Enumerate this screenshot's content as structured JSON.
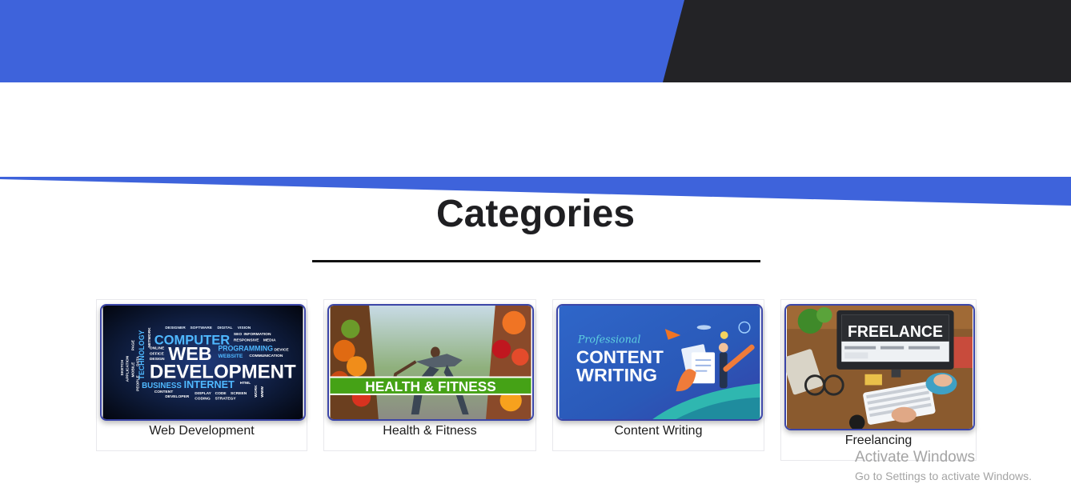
{
  "header": {
    "accent_color": "#3e63db",
    "dark_color": "#232326"
  },
  "section": {
    "title": "Categories"
  },
  "categories": [
    {
      "label": "Web Development",
      "image": "web-development-word-cloud",
      "image_text": {
        "w1": "COMPUTER",
        "w2": "WEB",
        "w3": "DEVELOPMENT",
        "w4": "BUSINESS",
        "w5": "INTERNET",
        "w6": "PROGRAMMING",
        "w7": "WEBSITE",
        "w8": "TECHNOLOGY",
        "w9": "DESIGNER",
        "w10": "SOFTWARE",
        "w11": "DIGITAL",
        "w12": "VISION",
        "w13": "SEO",
        "w14": "INFORMATION",
        "w15": "RESPONSIVE",
        "w16": "MEDIA",
        "w17": "DEVICE",
        "w18": "COMMUNICATION",
        "w19": "HTML",
        "w20": "DISPLAY",
        "w21": "CODE",
        "w22": "SCREEN",
        "w23": "CODING",
        "w24": "STRATEGY",
        "w25": "CONTENT",
        "w26": "DEVELOPER",
        "w27": "ONLINE",
        "w28": "OFFICE",
        "w29": "DESIGN",
        "w30": "SKETCH",
        "w31": "MOBILE",
        "w32": "PAGE",
        "w33": "APPLICATION",
        "w34": "PEOPLE",
        "w35": "LAPTOP",
        "w36": "PROGRAM",
        "w37": "DATA",
        "w38": "NETWORK",
        "w39": "WORK",
        "w40": "WWW"
      }
    },
    {
      "label": "Health & Fitness",
      "image": "health-fitness-banner",
      "image_text": {
        "banner": "HEALTH & FITNESS"
      }
    },
    {
      "label": "Content Writing",
      "image": "content-writing-illustration",
      "image_text": {
        "small": "Professional",
        "line1": "CONTENT",
        "line2": "WRITING"
      }
    },
    {
      "label": "Freelancing",
      "image": "freelance-desk-photo",
      "image_text": {
        "sign": "FREELANCE"
      }
    }
  ],
  "watermark": {
    "line1": "Activate Windows",
    "line2": "Go to Settings to activate Windows."
  }
}
